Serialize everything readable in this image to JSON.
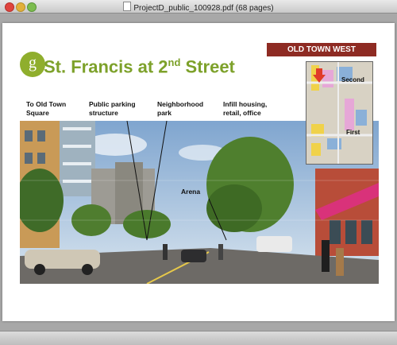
{
  "window": {
    "title": "ProjectD_public_100928.pdf (68 pages)"
  },
  "slide": {
    "logo_letter": "g",
    "title_main": "St. Francis at 2",
    "title_super": "nd",
    "title_end": " Street",
    "badge": "OLD TOWN WEST",
    "labels": {
      "old_town_1": "To Old Town",
      "old_town_2": "Square",
      "parking_1": "Public parking",
      "parking_2": "structure",
      "park_1": "Neighborhood",
      "park_2": "park",
      "infill_1": "Infill housing,",
      "infill_2": "retail, office",
      "arena": "Arena"
    },
    "map": {
      "second": "Second",
      "first": "First"
    }
  },
  "colors": {
    "accent_green": "#7da12a",
    "badge_red": "#8e2b23"
  }
}
